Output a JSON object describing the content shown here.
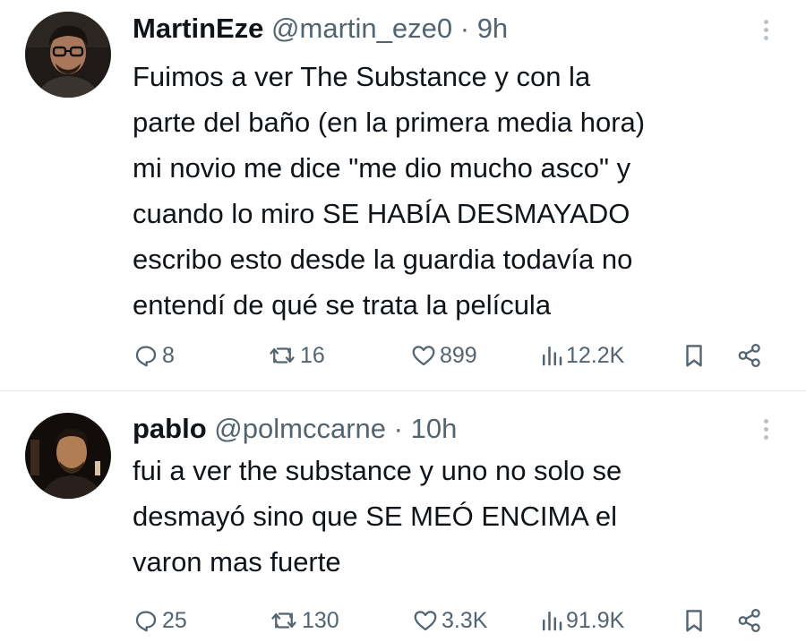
{
  "tweets": [
    {
      "user": {
        "name": "MartinEze",
        "handle": "@martin_eze0",
        "time": "9h"
      },
      "lines": [
        "Fuimos a ver The Substance y con la",
        "parte del baño (en la primera media hora)",
        "mi novio me dice \"me dio mucho asco\" y",
        "cuando lo miro SE HABÍA DESMAYADO",
        "escribo esto desde la guardia todavía no",
        "entendí de qué se trata la película"
      ],
      "stats": {
        "replies": "8",
        "reposts": "16",
        "likes": "899",
        "views": "12.2K"
      }
    },
    {
      "user": {
        "name": "pablo",
        "handle": "@polmccarne",
        "time": "10h"
      },
      "lines": [
        "fui a ver the substance y uno no solo se",
        "desmayó sino que SE MEÓ ENCIMA el",
        "varon mas fuerte"
      ],
      "stats": {
        "replies": "25",
        "reposts": "130",
        "likes": "3.3K",
        "views": "91.9K"
      }
    }
  ],
  "separator": "·",
  "icons": {
    "reply": "reply-icon",
    "repost": "repost-icon",
    "like": "heart-icon",
    "views": "views-icon",
    "bookmark": "bookmark-icon",
    "share": "share-icon",
    "more": "more-icon"
  },
  "colors": {
    "text": "#0f1419",
    "secondary": "#536471",
    "divider": "#e6e9ec"
  }
}
